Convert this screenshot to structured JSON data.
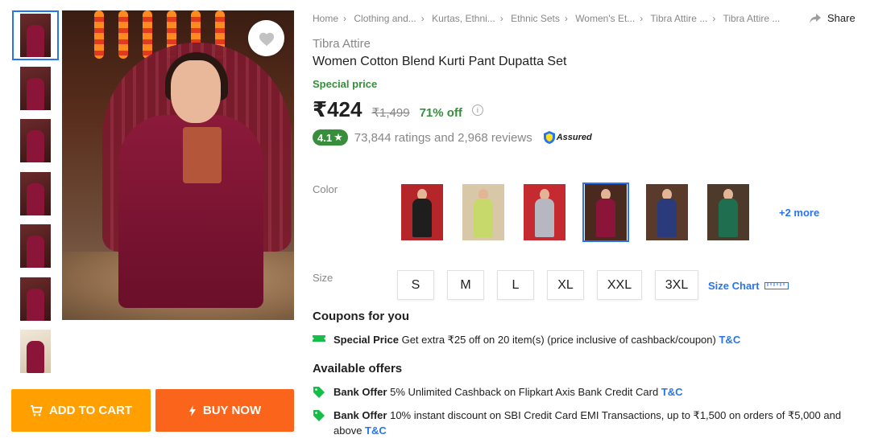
{
  "breadcrumbs": [
    "Home",
    "Clothing and...",
    "Kurtas, Ethni...",
    "Ethnic Sets",
    "Women's Et...",
    "Tibra Attire ...",
    "Tibra Attire ..."
  ],
  "share_label": "Share",
  "product": {
    "brand": "Tibra Attire",
    "title": "Women Cotton Blend Kurti Pant Dupatta Set",
    "special_label": "Special price",
    "price": "₹424",
    "mrp": "₹1,499",
    "discount": "71% off",
    "rating": "4.1",
    "rating_text": "73,844 ratings and 2,968 reviews",
    "assured_label": "Assured"
  },
  "colors": {
    "label": "Color",
    "more_label": "+2 more",
    "swatch_tints": [
      "#1e1e1e",
      "#c7d96a",
      "#b7b7c2",
      "#8a1538",
      "#2b3a7a",
      "#1f6e4f"
    ],
    "swatch_bgs": [
      "#b5262a",
      "#d9c8a8",
      "#c42a2f",
      "#4a2a1e",
      "#5a3a2a",
      "#4e3a2a"
    ],
    "selected_index": 3
  },
  "sizes": {
    "label": "Size",
    "options": [
      "S",
      "M",
      "L",
      "XL",
      "XXL",
      "3XL"
    ],
    "chart_label": "Size Chart"
  },
  "coupons": {
    "title": "Coupons for you",
    "items": [
      {
        "type": "Special Price",
        "text": "Get extra ₹25 off on 20 item(s) (price inclusive of cashback/coupon)",
        "tc": "T&C"
      }
    ]
  },
  "offers": {
    "title": "Available offers",
    "items": [
      {
        "type": "Bank Offer",
        "text": "5% Unlimited Cashback on Flipkart Axis Bank Credit Card",
        "tc": "T&C"
      },
      {
        "type": "Bank Offer",
        "text": "10% instant discount on SBI Credit Card EMI Transactions, up to ₹1,500 on orders of ₹5,000 and above",
        "tc": "T&C"
      }
    ]
  },
  "actions": {
    "add_to_cart": "ADD TO CART",
    "buy_now": "BUY NOW"
  },
  "colors_theme": {
    "accent_blue": "#2874f0",
    "green": "#388e3c",
    "cart_orange": "#ff9f00",
    "buy_orange": "#fb641b"
  }
}
